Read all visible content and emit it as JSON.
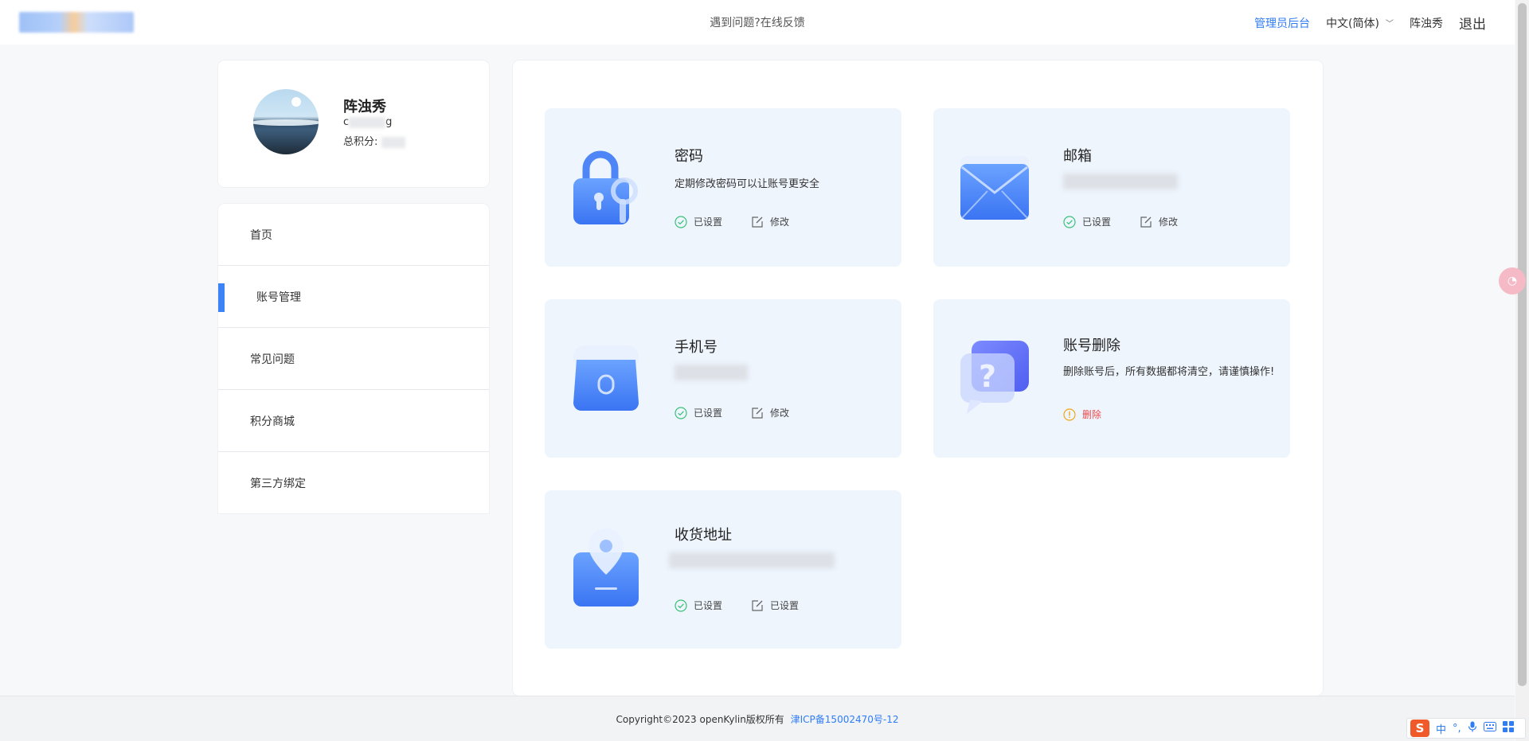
{
  "header": {
    "feedback": "遇到问题?在线反馈",
    "admin": "管理员后台",
    "language": "中文(简体)",
    "username": "阵浊秀",
    "logout": "退出"
  },
  "profile": {
    "name": "阵浊秀",
    "id_prefix": "c",
    "id_suffix": "g",
    "points_label": "总积分:"
  },
  "menu": {
    "items": [
      {
        "label": "首页"
      },
      {
        "label": "账号管理"
      },
      {
        "label": "常见问题"
      },
      {
        "label": "积分商城"
      },
      {
        "label": "第三方绑定"
      }
    ]
  },
  "cards": {
    "password": {
      "title": "密码",
      "desc": "定期修改密码可以让账号更安全",
      "status": "已设置",
      "action": "修改"
    },
    "email": {
      "title": "邮箱",
      "status": "已设置",
      "action": "修改"
    },
    "phone": {
      "title": "手机号",
      "status": "已设置",
      "action": "修改"
    },
    "delete": {
      "title": "账号删除",
      "desc": "删除账号后，所有数据都将清空，请谨慎操作!",
      "action": "删除"
    },
    "address": {
      "title": "收货地址",
      "status": "已设置",
      "action": "已设置"
    }
  },
  "footer": {
    "copyright": "Copyright©2023 openKylin版权所有",
    "icp": "津ICP备15002470号-12"
  },
  "ime": {
    "lang": "中",
    "punct": "°,"
  },
  "colors": {
    "accent": "#2f7cf6",
    "card_bg": "#eef5fd",
    "danger": "#e84c4c",
    "success": "#3cc07a",
    "warning": "#f0a61a"
  }
}
